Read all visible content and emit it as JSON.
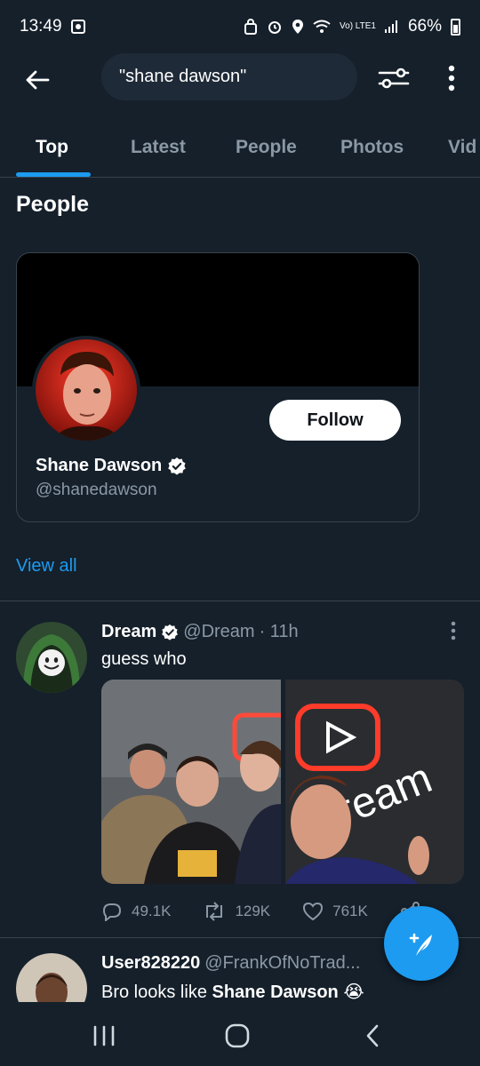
{
  "status_bar": {
    "time": "13:49",
    "network_label": "Vo) LTE1",
    "battery": "66%"
  },
  "search": {
    "query": "\"shane dawson\""
  },
  "tabs": [
    {
      "label": "Top",
      "active": true
    },
    {
      "label": "Latest",
      "active": false
    },
    {
      "label": "People",
      "active": false
    },
    {
      "label": "Photos",
      "active": false
    },
    {
      "label": "Vid",
      "active": false
    }
  ],
  "people_section": {
    "title": "People",
    "card": {
      "name": "Shane Dawson",
      "handle": "@shanedawson",
      "verified": true,
      "follow_label": "Follow"
    },
    "view_all": "View all"
  },
  "tweets": [
    {
      "name": "Dream",
      "verified": true,
      "handle": "@Dream",
      "time": "· 11h",
      "text": "guess who",
      "replies": "49.1K",
      "retweets": "129K",
      "likes": "761K"
    },
    {
      "name": "User828220",
      "handle": "@FrankOfNoTrad...",
      "text_prefix": "Bro looks like ",
      "text_bold": "Shane Dawson",
      "emoji": "😭"
    }
  ],
  "colors": {
    "background": "#15202b",
    "accent": "#1d9bf0",
    "muted": "#8b98a5",
    "divider": "#38444d"
  }
}
